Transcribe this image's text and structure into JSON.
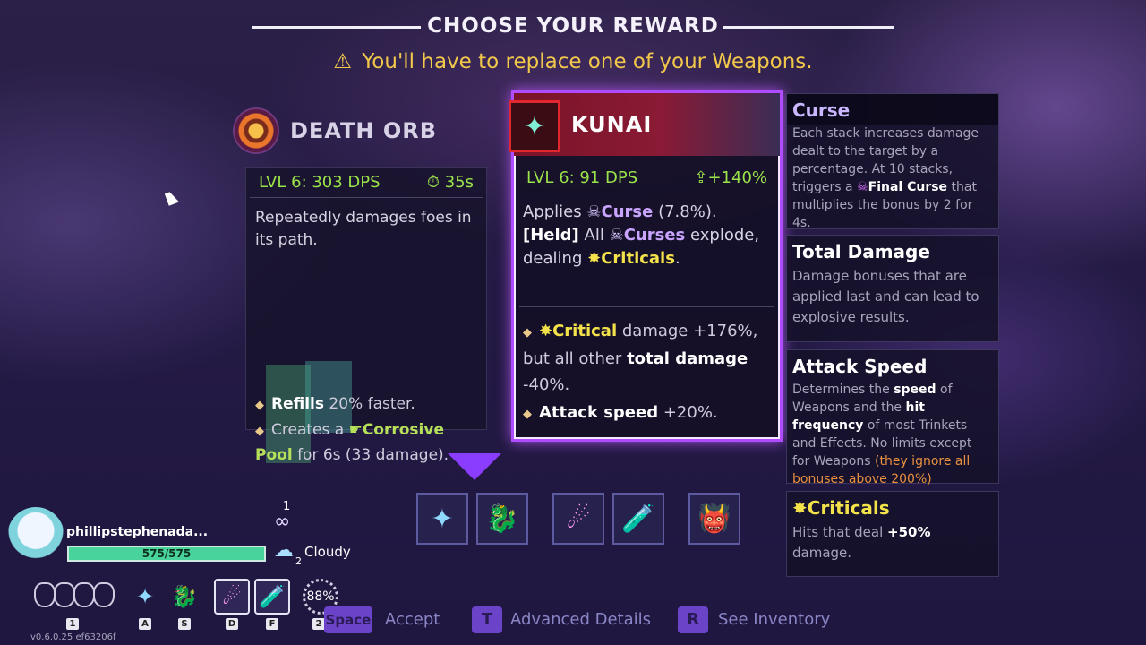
{
  "header": {
    "title": "CHOOSE YOUR REWARD",
    "warning_icon": "⚠",
    "warning_text": "You'll have to replace one of your Weapons."
  },
  "card_left": {
    "name": "DEATH ORB",
    "stat": "LVL 6: 303 DPS",
    "cooldown_icon": "stopwatch-icon",
    "cooldown": "35s",
    "desc": "Repeatedly damages foes in its path.",
    "b1_pre": "Refills",
    "b1_post": "20% faster.",
    "b2_pre": "Creates a",
    "b2_kw": "Corrosive Pool",
    "b2_post": "for 6s (33 damage)."
  },
  "card_right": {
    "name": "KUNAI",
    "stat": "LVL 6: 91 DPS",
    "change": "+140%",
    "l1_pre": "Applies",
    "l1_kw": "Curse",
    "l1_post": "(7.8%).",
    "l2_held": "[Held]",
    "l2_pre": "All",
    "l2_kw": "Curses",
    "l2_post": "explode,",
    "l3_pre": "dealing",
    "l3_kw": "Criticals",
    "l3_post": ".",
    "b1_kw": "Critical",
    "b1_a": "damage +176%, but all other",
    "b1_bold": "total damage",
    "b1_b": "-40%.",
    "b2_bold": "Attack speed",
    "b2_post": "+20%."
  },
  "tooltips": {
    "curse_title": "Curse",
    "curse_a": "Each stack increases damage dealt to the target by a percentage. At 10 stacks, triggers a",
    "curse_kw": "Final Curse",
    "curse_b": "that multiplies the bonus by 2 for 4s.",
    "total_title": "Total Damage",
    "total_text": "Damage bonuses that are applied last and can lead to explosive results.",
    "speed_title": "Attack Speed",
    "speed_a": "Determines the",
    "speed_b1": "speed",
    "speed_c": "of Weapons and the",
    "speed_b2": "hit frequency",
    "speed_d": "of most Trinkets and Effects. No limits except for Weapons",
    "speed_orange": "(they ignore all bonuses above 200%)",
    "crit_title": "Criticals",
    "crit_a": "Hits that deal",
    "crit_b": "+50%",
    "crit_c": "damage."
  },
  "inventory": [
    {
      "icon": "kunai-icon",
      "glyph": "✦"
    },
    {
      "icon": "dragon-icon",
      "glyph": "🐉"
    },
    {
      "icon": "comet-icon",
      "glyph": "☄"
    },
    {
      "icon": "potion-jar-icon",
      "glyph": "🧪"
    },
    {
      "icon": "monster-orb-icon",
      "glyph": "👹"
    }
  ],
  "player": {
    "name": "phillipstephenada...",
    "hp_text": "575/575",
    "hp_fraction": 1.0,
    "infinity_count": "1",
    "weather_count": "2",
    "weather": "Cloudy",
    "percent": "88%",
    "keys": [
      "1",
      "A",
      "S",
      "D",
      "F",
      "2"
    ],
    "version": "v0.6.0.25 ef63206f"
  },
  "actions": {
    "accept_key": "Space",
    "accept": "Accept",
    "details_key": "T",
    "details": "Advanced Details",
    "inventory_key": "R",
    "inventory": "See Inventory"
  },
  "colors": {
    "accent_purple": "#b04cff",
    "green_stat": "#9be34a",
    "warning_yellow": "#f2c84b"
  }
}
